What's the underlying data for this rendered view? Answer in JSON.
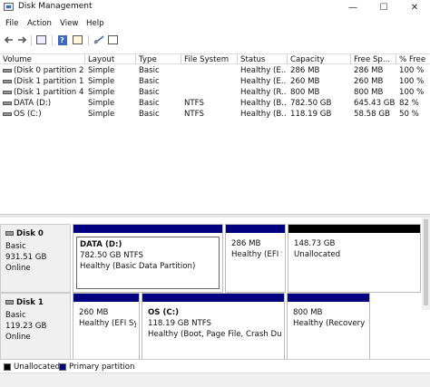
{
  "window": {
    "title": "Disk Management",
    "minimize": "—",
    "maximize": "☐",
    "close": "✕"
  },
  "menu": [
    "File",
    "Action",
    "View",
    "Help"
  ],
  "toolbar": {
    "buttons": [
      "back-arrow-icon",
      "forward-arrow-icon",
      "console-tree-icon",
      "help-icon",
      "properties-icon",
      "connect-icon",
      "settings-icon"
    ]
  },
  "volume_list": {
    "columns": [
      "Volume",
      "Layout",
      "Type",
      "File System",
      "Status",
      "Capacity",
      "Free Sp...",
      "% Free"
    ],
    "rows": [
      {
        "volume": "(Disk 0 partition 2)",
        "layout": "Simple",
        "type": "Basic",
        "fs": "",
        "status": "Healthy (E...",
        "capacity": "286 MB",
        "free": "286 MB",
        "pct": "100 %"
      },
      {
        "volume": "(Disk 1 partition 1)",
        "layout": "Simple",
        "type": "Basic",
        "fs": "",
        "status": "Healthy (E...",
        "capacity": "260 MB",
        "free": "260 MB",
        "pct": "100 %"
      },
      {
        "volume": "(Disk 1 partition 4)",
        "layout": "Simple",
        "type": "Basic",
        "fs": "",
        "status": "Healthy (R...",
        "capacity": "800 MB",
        "free": "800 MB",
        "pct": "100 %"
      },
      {
        "volume": "DATA (D:)",
        "layout": "Simple",
        "type": "Basic",
        "fs": "NTFS",
        "status": "Healthy (B...",
        "capacity": "782.50 GB",
        "free": "645.43 GB",
        "pct": "82 %"
      },
      {
        "volume": "OS (C:)",
        "layout": "Simple",
        "type": "Basic",
        "fs": "NTFS",
        "status": "Healthy (B...",
        "capacity": "118.19 GB",
        "free": "58.58 GB",
        "pct": "50 %"
      }
    ]
  },
  "disks": [
    {
      "name": "Disk 0",
      "type": "Basic",
      "size": "931.51 GB",
      "state": "Online",
      "partitions": [
        {
          "name": "DATA (D:)",
          "size": "782.50 GB NTFS",
          "status": "Healthy (Basic Data Partition)",
          "kind": "primary"
        },
        {
          "name": "",
          "size": "286 MB",
          "status": "Healthy (EFI Sy",
          "kind": "primary"
        },
        {
          "name": "",
          "size": "148.73 GB",
          "status": "Unallocated",
          "kind": "unallocated"
        }
      ]
    },
    {
      "name": "Disk 1",
      "type": "Basic",
      "size": "119.23 GB",
      "state": "Online",
      "partitions": [
        {
          "name": "",
          "size": "260 MB",
          "status": "Healthy (EFI Syst",
          "kind": "primary"
        },
        {
          "name": "OS (C:)",
          "size": "118.19 GB NTFS",
          "status": "Healthy (Boot, Page File, Crash Dump,",
          "kind": "primary"
        },
        {
          "name": "",
          "size": "800 MB",
          "status": "Healthy (Recovery Pa",
          "kind": "primary"
        }
      ]
    }
  ],
  "legend": [
    {
      "label": "Unallocated",
      "color": "#000000"
    },
    {
      "label": "Primary partition",
      "color": "#000080"
    }
  ],
  "colors": {
    "primary": "#000080",
    "unallocated": "#000000"
  }
}
